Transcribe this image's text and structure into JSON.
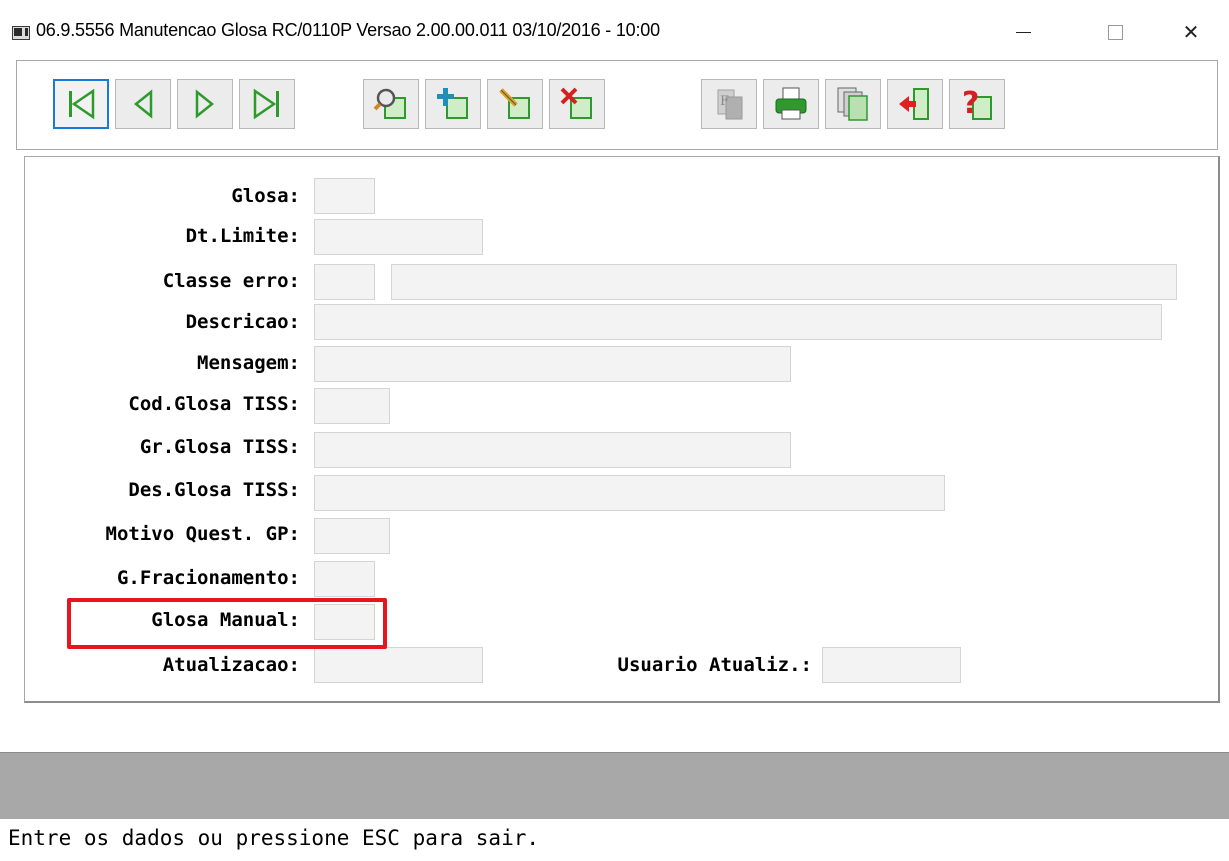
{
  "window": {
    "title": "06.9.5556 Manutencao  Glosa RC/0110P Versao 2.00.00.011 03/10/2016 - 10:00",
    "close_glyph": "✕"
  },
  "toolbar": {
    "nav": [
      "first-record-icon",
      "previous-record-icon",
      "next-record-icon",
      "last-record-icon"
    ],
    "actions": [
      "search-icon",
      "add-icon",
      "edit-icon",
      "delete-icon"
    ],
    "tools": [
      "filter-icon",
      "print-icon",
      "copy-icon",
      "exit-icon",
      "help-icon"
    ],
    "accent": "#1a78d6",
    "icon_color": "#2e9a2e"
  },
  "form": {
    "glosa_label": "Glosa:",
    "dt_limite_label": "Dt.Limite:",
    "classe_erro_label": "Classe erro:",
    "descricao_label": "Descricao:",
    "mensagem_label": "Mensagem:",
    "cod_glosa_tiss_label": "Cod.Glosa TISS:",
    "gr_glosa_tiss_label": "Gr.Glosa TISS:",
    "des_glosa_tiss_label": "Des.Glosa TISS:",
    "motivo_quest_label": "Motivo Quest. GP:",
    "g_fracionamento_label": "G.Fracionamento:",
    "glosa_manual_label": "Glosa Manual:",
    "atualizacao_label": "Atualizacao:",
    "usuario_atualiz_label": "Usuario Atualiz.:",
    "values": {
      "glosa": "",
      "dt_limite": "",
      "classe_erro": "",
      "classe_erro_desc": "",
      "descricao": "",
      "mensagem": "",
      "cod_glosa_tiss": "",
      "gr_glosa_tiss": "",
      "des_glosa_tiss": "",
      "motivo_quest": "",
      "g_fracionamento": "",
      "glosa_manual": "",
      "atualizacao": "",
      "usuario_atualiz": ""
    },
    "highlight_color": "#e8141e"
  },
  "status": {
    "message": "Entre os dados ou pressione ESC para sair."
  }
}
